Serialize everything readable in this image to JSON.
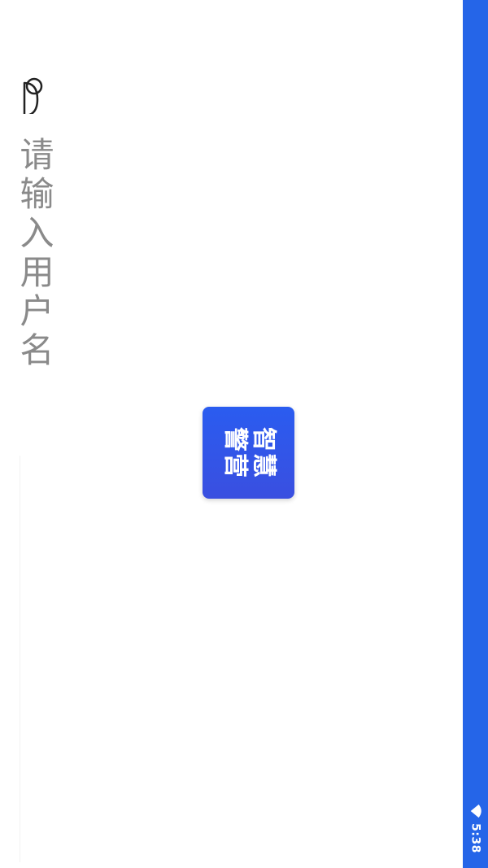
{
  "status_bar": {
    "time": "5:38",
    "icons": [
      "wifi-icon"
    ],
    "color": "#2565e8"
  },
  "login": {
    "username_placeholder": "请输入用户名",
    "user_icon": "user-icon"
  },
  "logo": {
    "line1": "智慧",
    "line2": "警营",
    "color": "#2a5cf0"
  }
}
